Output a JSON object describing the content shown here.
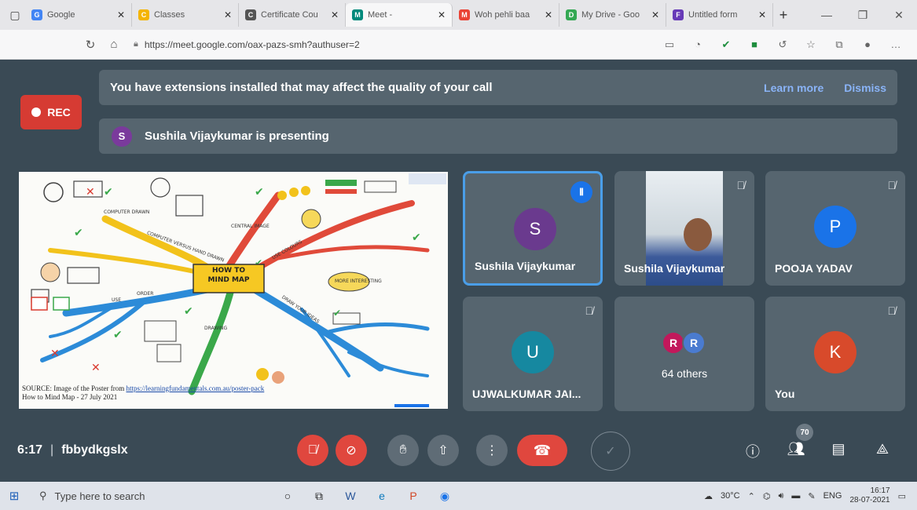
{
  "browser": {
    "tabs": [
      {
        "title": "Google",
        "favicon": "G",
        "color": "#4285f4"
      },
      {
        "title": "Classes",
        "favicon": "C",
        "color": "#f4b400"
      },
      {
        "title": "Certificate Cou",
        "favicon": "C",
        "color": "#555555"
      },
      {
        "title": "Meet - ",
        "favicon": "M",
        "color": "#00897b"
      },
      {
        "title": "Woh pehli baa",
        "favicon": "M",
        "color": "#ea4335"
      },
      {
        "title": "My Drive - Goo",
        "favicon": "D",
        "color": "#34a853"
      },
      {
        "title": "Untitled form",
        "favicon": "F",
        "color": "#673ab7"
      }
    ],
    "url": "https://meet.google.com/oax-pazs-smh?authuser=2"
  },
  "meet": {
    "rec_label": "REC",
    "extension_banner": {
      "text": "You have extensions installed that may affect the quality of your call",
      "learn_more": "Learn more",
      "dismiss": "Dismiss"
    },
    "presenting": {
      "avatar_letter": "S",
      "text": "Sushila Vijaykumar is presenting"
    },
    "slide": {
      "title_line1": "HOW TO",
      "title_line2": "MIND MAP",
      "labels": [
        "CENTRAL IMAGE",
        "COMPUTER DRAWN",
        "USE COLOURS",
        "COMPUTER VERSUS HAND DRAWN",
        "ORDER",
        "DRAW YOUR IDEAS",
        "DRAWING",
        "USE",
        "MORE INTERESTING"
      ],
      "source_prefix": "SOURCE: Image of the Poster from ",
      "source_link": "https://learningfundamentals.com.au/poster-pack",
      "source_line2": "How to Mind Map - 27 July 2021"
    },
    "participants": [
      {
        "name": "Sushila Vijaykumar",
        "initial": "S",
        "avatar_color": "#6a3a8e",
        "speaking": true
      },
      {
        "name": "Sushila Vijaykumar",
        "video": true
      },
      {
        "name": "POOJA YADAV",
        "initial": "P",
        "avatar_color": "#1a73e8"
      },
      {
        "name": "UJWALKUMAR JAI...",
        "initial": "U",
        "avatar_color": "#1688a0"
      },
      {
        "name": "64 others",
        "avatars": [
          "R",
          "R"
        ],
        "avatar_colors": [
          "#c2185b",
          "#4a7bd0"
        ]
      },
      {
        "name": "You",
        "initial": "K",
        "avatar_color": "#d84a2b"
      }
    ],
    "controls": {
      "time": "6:17",
      "meeting_code": "fbbydkgslx",
      "people_count": "70"
    }
  },
  "taskbar": {
    "search_placeholder": "Type here to search",
    "temperature": "30°C",
    "language": "ENG",
    "time": "16:17",
    "date": "28-07-2021"
  }
}
